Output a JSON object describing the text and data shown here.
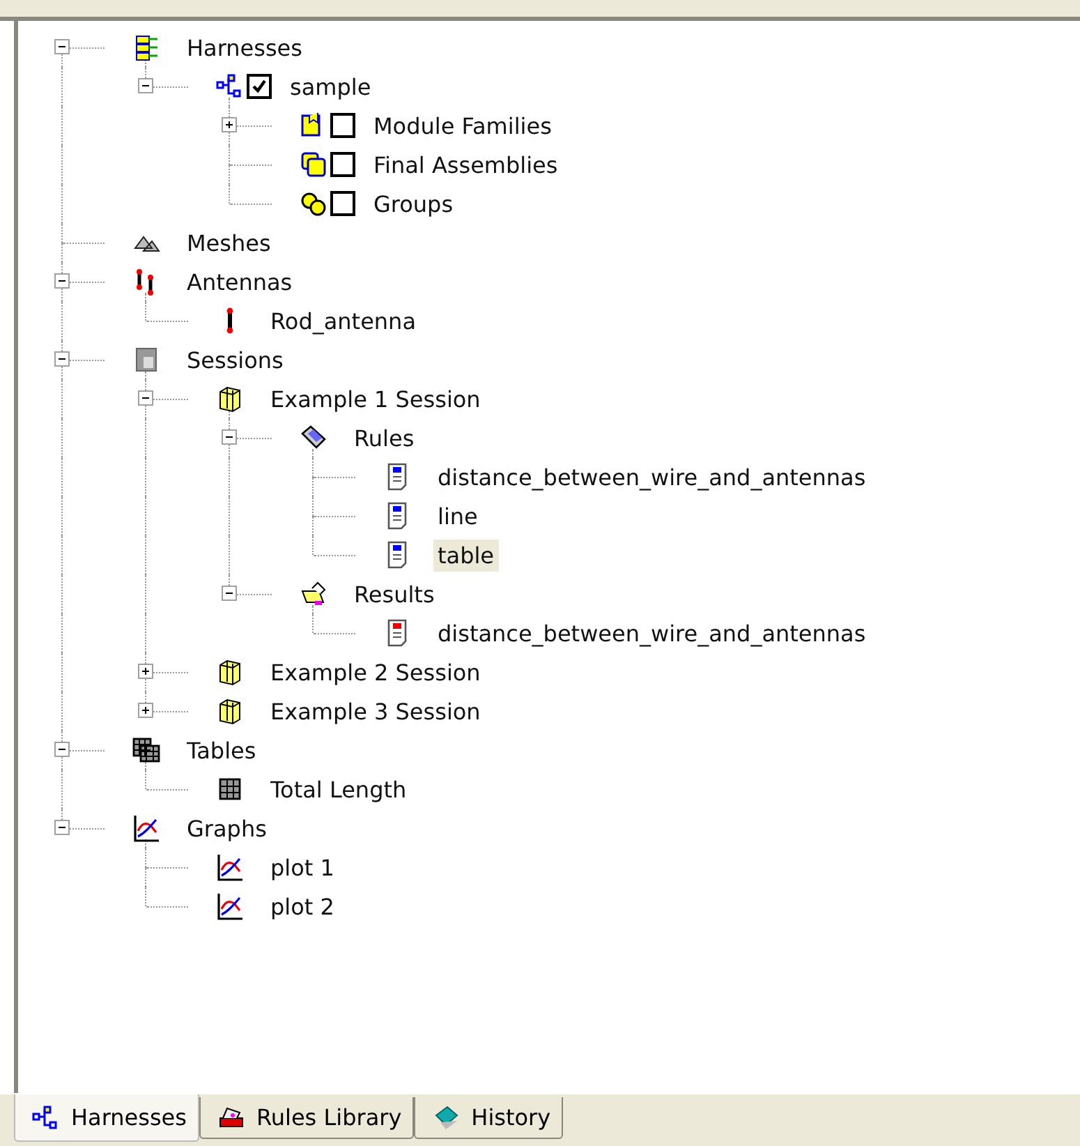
{
  "tree": [
    {
      "label": "Harnesses",
      "kind": "harnesses",
      "expanded": true,
      "selected": false,
      "children": [
        {
          "label": "sample",
          "kind": "harness",
          "expanded": true,
          "checked": true,
          "selected": false,
          "children": [
            {
              "label": "Module Families",
              "kind": "module-families",
              "expanded": false,
              "checked": false,
              "selected": false
            },
            {
              "label": "Final Assemblies",
              "kind": "final-assemblies",
              "checked": false,
              "selected": false
            },
            {
              "label": "Groups",
              "kind": "groups",
              "checked": false,
              "selected": false
            }
          ]
        }
      ]
    },
    {
      "label": "Meshes",
      "kind": "meshes",
      "selected": false
    },
    {
      "label": "Antennas",
      "kind": "antennas",
      "expanded": true,
      "selected": false,
      "children": [
        {
          "label": "Rod_antenna",
          "kind": "antenna",
          "selected": false
        }
      ]
    },
    {
      "label": "Sessions",
      "kind": "sessions",
      "expanded": true,
      "selected": false,
      "children": [
        {
          "label": "Example 1 Session",
          "kind": "session",
          "expanded": true,
          "selected": false,
          "children": [
            {
              "label": "Rules",
              "kind": "rules",
              "expanded": true,
              "selected": false,
              "children": [
                {
                  "label": "distance_between_wire_and_antennas",
                  "kind": "rule",
                  "selected": false
                },
                {
                  "label": "line",
                  "kind": "rule",
                  "selected": false
                },
                {
                  "label": "table",
                  "kind": "rule",
                  "selected": true
                }
              ]
            },
            {
              "label": "Results",
              "kind": "results",
              "expanded": true,
              "selected": false,
              "children": [
                {
                  "label": "distance_between_wire_and_antennas",
                  "kind": "result",
                  "selected": false
                }
              ]
            }
          ]
        },
        {
          "label": "Example 2 Session",
          "kind": "session",
          "expanded": false,
          "selected": false
        },
        {
          "label": "Example 3 Session",
          "kind": "session",
          "expanded": false,
          "selected": false
        }
      ]
    },
    {
      "label": "Tables",
      "kind": "tables",
      "expanded": true,
      "selected": false,
      "children": [
        {
          "label": "Total Length",
          "kind": "table",
          "selected": false
        }
      ]
    },
    {
      "label": "Graphs",
      "kind": "graphs",
      "expanded": true,
      "selected": false,
      "children": [
        {
          "label": "plot 1",
          "kind": "graph",
          "selected": false
        },
        {
          "label": "plot 2",
          "kind": "graph",
          "selected": false
        }
      ]
    }
  ],
  "tabs": [
    {
      "label": "Harnesses",
      "kind": "harnesses",
      "selected": true
    },
    {
      "label": "Rules Library",
      "kind": "rules-library",
      "selected": false
    },
    {
      "label": "History",
      "kind": "history",
      "selected": false
    }
  ]
}
